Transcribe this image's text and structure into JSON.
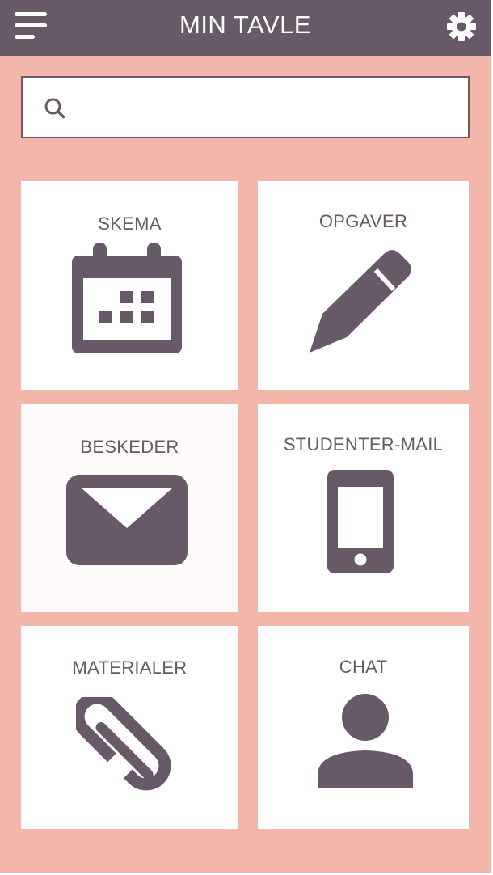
{
  "header": {
    "title": "MIN TAVLE",
    "menu_icon": "hamburger-menu-icon",
    "settings_icon": "gear-icon"
  },
  "search": {
    "icon": "search-icon",
    "placeholder": "",
    "value": ""
  },
  "tiles": [
    {
      "label": "SKEMA",
      "icon": "calendar-icon"
    },
    {
      "label": "OPGAVER",
      "icon": "pencil-icon"
    },
    {
      "label": "BESKEDER",
      "icon": "envelope-icon"
    },
    {
      "label": "STUDENTER-MAIL",
      "icon": "phone-icon"
    },
    {
      "label": "MATERIALER",
      "icon": "paperclip-icon"
    },
    {
      "label": "CHAT",
      "icon": "person-icon"
    }
  ],
  "colors": {
    "background": "#f3b6ab",
    "header": "#675968",
    "accent": "#675968",
    "tile": "#ffffff"
  }
}
